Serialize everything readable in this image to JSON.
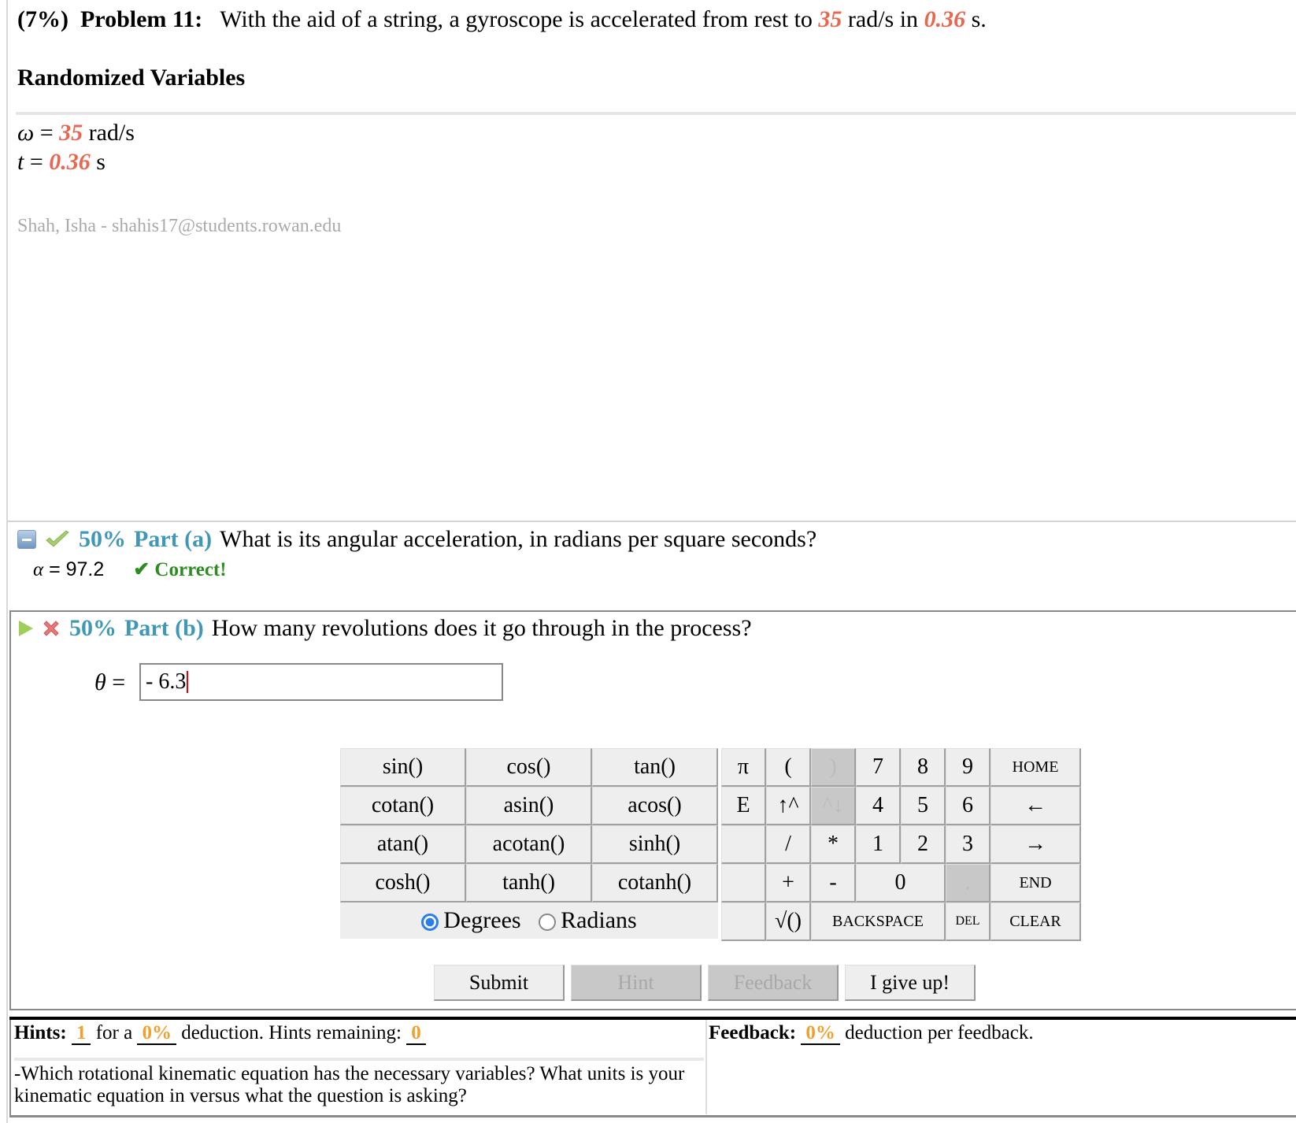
{
  "problem": {
    "weight": "(7%)",
    "label": "Problem 11:",
    "text_before": "With the aid of a string, a gyroscope is accelerated from rest to",
    "omega_value": "35",
    "text_mid": "rad/s in",
    "t_value": "0.36",
    "text_after": "s."
  },
  "randomized": {
    "heading": "Randomized Variables",
    "vars": [
      {
        "symbol": "ω",
        "eq": " = ",
        "value": "35",
        "unit": " rad/s"
      },
      {
        "symbol": "t",
        "eq": " = ",
        "value": "0.36",
        "unit": " s"
      }
    ]
  },
  "user": "Shah, Isha - shahis17@students.rowan.edu",
  "part_a": {
    "percent": "50%",
    "label": "Part (a)",
    "question": "What is its angular acceleration, in radians per square seconds?",
    "answer_symbol": "α",
    "answer": " = 97.2",
    "status": "✔ Correct!"
  },
  "part_b": {
    "percent": "50%",
    "label": "Part (b)",
    "question": "How many revolutions does it go through in the process?",
    "input_symbol": "θ",
    "input_eq": " = ",
    "input_value": "- 6.3"
  },
  "keypad": {
    "functions": [
      [
        "sin()",
        "cos()",
        "tan()"
      ],
      [
        "cotan()",
        "asin()",
        "acos()"
      ],
      [
        "atan()",
        "acotan()",
        "sinh()"
      ],
      [
        "cosh()",
        "tanh()",
        "cotanh()"
      ]
    ],
    "mode": {
      "degrees": "Degrees",
      "radians": "Radians",
      "selected": "Degrees"
    },
    "keys": {
      "pi": "π",
      "lparen": "(",
      "rparen": ")",
      "e": "E",
      "up": "↑^",
      "down": "^↓",
      "div": "/",
      "mul": "*",
      "plus": "+",
      "minus": "-",
      "sqrt": "√()",
      "n7": "7",
      "n8": "8",
      "n9": "9",
      "n4": "4",
      "n5": "5",
      "n6": "6",
      "n1": "1",
      "n2": "2",
      "n3": "3",
      "n0": "0",
      "dot": ".",
      "home": "HOME",
      "left": "←",
      "right": "→",
      "end": "END",
      "backspace": "BACKSPACE",
      "del": "DEL",
      "clear": "CLEAR"
    }
  },
  "buttons": {
    "submit": "Submit",
    "hint": "Hint",
    "feedback": "Feedback",
    "giveup": "I give up!"
  },
  "hints": {
    "label": "Hints:",
    "count": "1",
    "for_a": "for a",
    "deduction": "0%",
    "mid": "deduction. Hints remaining:",
    "remaining": "0",
    "text": "-Which rotational kinematic equation has the necessary variables? What units is your kinematic equation in versus what the question is asking?"
  },
  "feedback": {
    "label": "Feedback:",
    "deduction": "0%",
    "text": "deduction per feedback."
  }
}
